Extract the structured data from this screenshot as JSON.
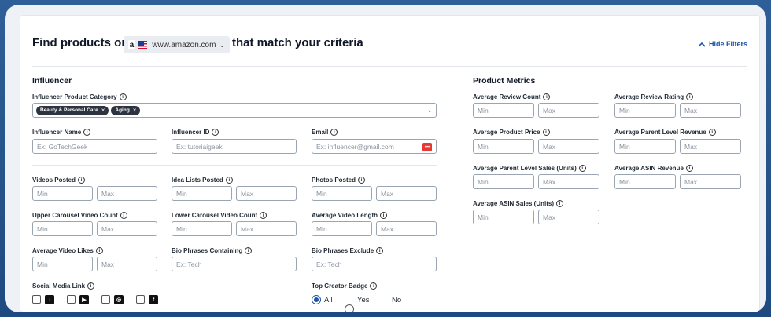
{
  "header": {
    "title_prefix": "Find products on",
    "site": "www.amazon.com",
    "amazon_mark": "a",
    "title_suffix": "that match your criteria",
    "hide_filters": "Hide Filters"
  },
  "influencer": {
    "heading": "Influencer",
    "category_label": "Influencer Product Category",
    "category_tags": [
      "Beauty & Personal Care",
      "Aging"
    ],
    "name_label": "Influencer Name",
    "name_placeholder": "Ex: GoTechGeek",
    "id_label": "Influencer ID",
    "id_placeholder": "Ex: tutoriaigeek",
    "email_label": "Email",
    "email_placeholder": "Ex: influencer@gmail.com",
    "email_btn": "•••",
    "videos_posted": "Videos Posted",
    "idea_lists": "Idea Lists Posted",
    "photos_posted": "Photos Posted",
    "upper_carousel": "Upper Carousel Video Count",
    "lower_carousel": "Lower Carousel Video Count",
    "avg_video_length": "Average Video Length",
    "avg_video_likes": "Average Video Likes",
    "bio_containing": "Bio Phrases Containing",
    "bio_containing_placeholder": "Ex: Tech",
    "bio_exclude": "Bio Phrases Exclude",
    "bio_exclude_placeholder": "Ex: Tech",
    "social_label": "Social Media Link",
    "social_icons": [
      "tiktok-icon",
      "youtube-icon",
      "instagram-icon",
      "facebook-icon"
    ],
    "social_glyphs": [
      "♪",
      "▶",
      "◎",
      "f"
    ],
    "badge_label": "Top Creator Badge",
    "badge_options": [
      "All",
      "Yes",
      "No"
    ],
    "badge_selected": "All"
  },
  "common": {
    "min": "Min",
    "max": "Max",
    "info": "i",
    "dropdown": "⌄"
  },
  "metrics": {
    "heading": "Product Metrics",
    "review_count": "Average Review Count",
    "review_rating": "Average Review Rating",
    "product_price": "Average Product Price",
    "parent_revenue": "Average Parent Level Revenue",
    "parent_sales": "Average Parent Level Sales (Units)",
    "asin_revenue": "Average ASIN Revenue",
    "asin_sales": "Average ASIN Sales (Units)"
  },
  "colors": {
    "accent": "#1e55a5",
    "frame": "#2f5f98",
    "tag_bg": "#2d3440"
  }
}
